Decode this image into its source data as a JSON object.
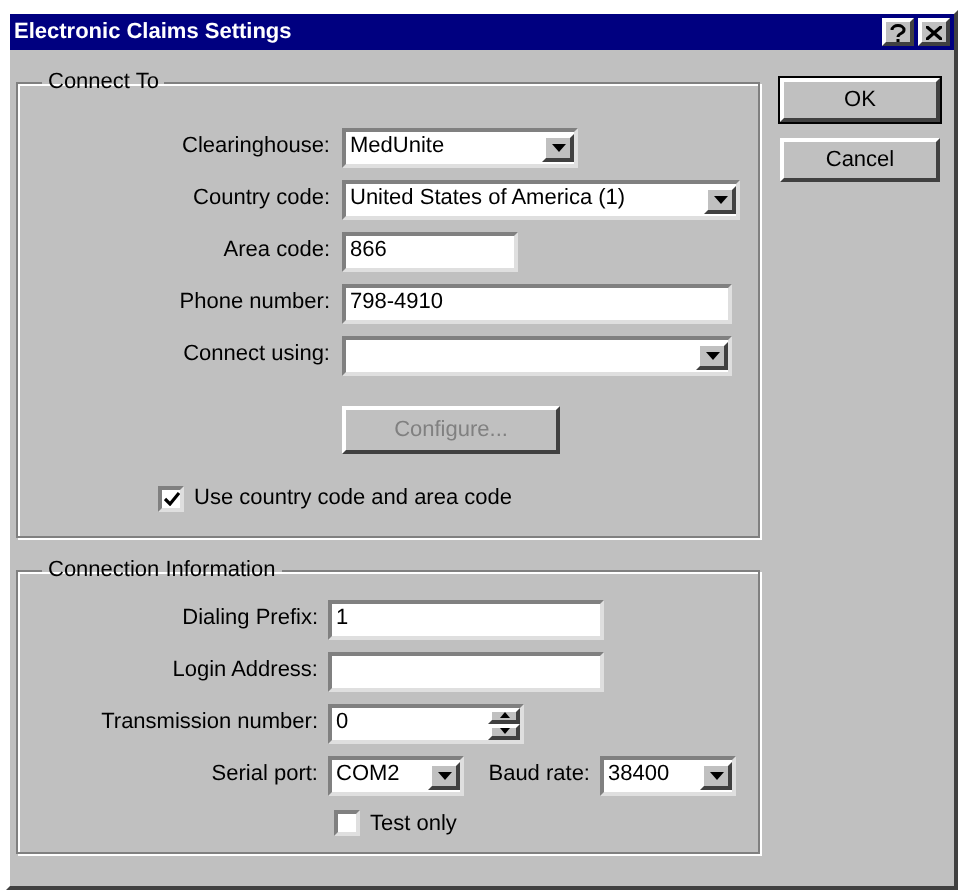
{
  "window": {
    "title": "Electronic Claims Settings"
  },
  "connect_to": {
    "title": "Connect To",
    "fields": [
      {
        "kind": "combo",
        "label": "Clearinghouse:",
        "value": "MedUnite"
      },
      {
        "kind": "combo",
        "label": "Country code:",
        "value": "United States of America (1)"
      },
      {
        "kind": "text",
        "label": "Area code:",
        "value": "866"
      },
      {
        "kind": "text",
        "label": "Phone number:",
        "value": "798-4910"
      },
      {
        "kind": "combo",
        "label": "Connect using:"
      }
    ],
    "configure_button": {
      "label": "Configure...",
      "disabled": true
    },
    "checkbox": {
      "label": "Use country code and area code",
      "checked": true
    }
  },
  "connection_info": {
    "title": "Connection Information",
    "fields": [
      {
        "kind": "text",
        "label": "Dialing Prefix:",
        "value": "1"
      },
      {
        "kind": "text",
        "label": "Login Address:"
      },
      {
        "kind": "spinner",
        "label": "Transmission number:",
        "value": "0"
      },
      {
        "kind": "combo",
        "label": "Serial port:",
        "value": "COM2"
      },
      {
        "kind": "combo",
        "label": "Baud rate:",
        "value": "38400"
      }
    ],
    "checkbox": {
      "label": "Test only",
      "checked": false
    }
  },
  "buttons": [
    {
      "label": "OK",
      "default": true
    },
    {
      "label": "Cancel",
      "default": false
    }
  ]
}
